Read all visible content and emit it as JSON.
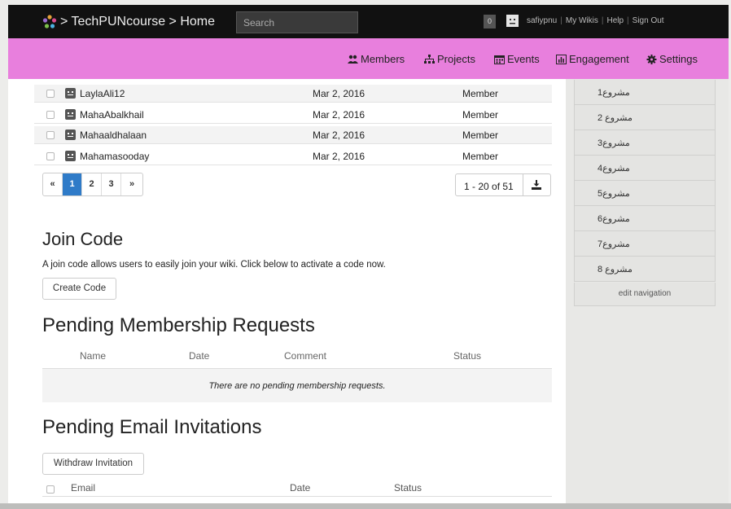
{
  "header": {
    "breadcrumb": "> TechPUNcourse > Home",
    "search_placeholder": "Search",
    "notification_count": "0",
    "username": "safiypnu",
    "links": [
      "My Wikis",
      "Help",
      "Sign Out"
    ]
  },
  "nav": {
    "items": [
      "Members",
      "Projects",
      "Events",
      "Engagement",
      "Settings"
    ],
    "bar_color": "#e87fdd"
  },
  "members": {
    "rows": [
      {
        "name": "LaylaAli12",
        "date": "Mar 2, 2016",
        "role": "Member"
      },
      {
        "name": "MahaAbalkhail",
        "date": "Mar 2, 2016",
        "role": "Member"
      },
      {
        "name": "Mahaaldhalaan",
        "date": "Mar 2, 2016",
        "role": "Member"
      },
      {
        "name": "Mahamasooday",
        "date": "Mar 2, 2016",
        "role": "Member"
      }
    ],
    "pages": [
      "«",
      "1",
      "2",
      "3",
      "»"
    ],
    "active_page": "1",
    "range": "1 - 20 of 51"
  },
  "join_code": {
    "title": "Join Code",
    "description": "A join code allows users to easily join your wiki. Click below to activate a code now.",
    "button": "Create Code"
  },
  "pending_requests": {
    "title": "Pending Membership Requests",
    "columns": [
      "Name",
      "Date",
      "Comment",
      "Status"
    ],
    "empty_message": "There are no pending membership requests."
  },
  "email_invitations": {
    "title": "Pending Email Invitations",
    "button": "Withdraw Invitation",
    "columns": [
      "Email",
      "Date",
      "Status"
    ]
  },
  "sidebar": {
    "items": [
      "مشروع1",
      "مشروع 2",
      "مشروع3",
      "مشروع4",
      "مشروع5",
      "مشروع6",
      "مشروع7",
      "مشروع 8"
    ],
    "edit_label": "edit navigation"
  },
  "colors": {
    "accent": "#2f7bc8",
    "topbar": "#111111"
  }
}
